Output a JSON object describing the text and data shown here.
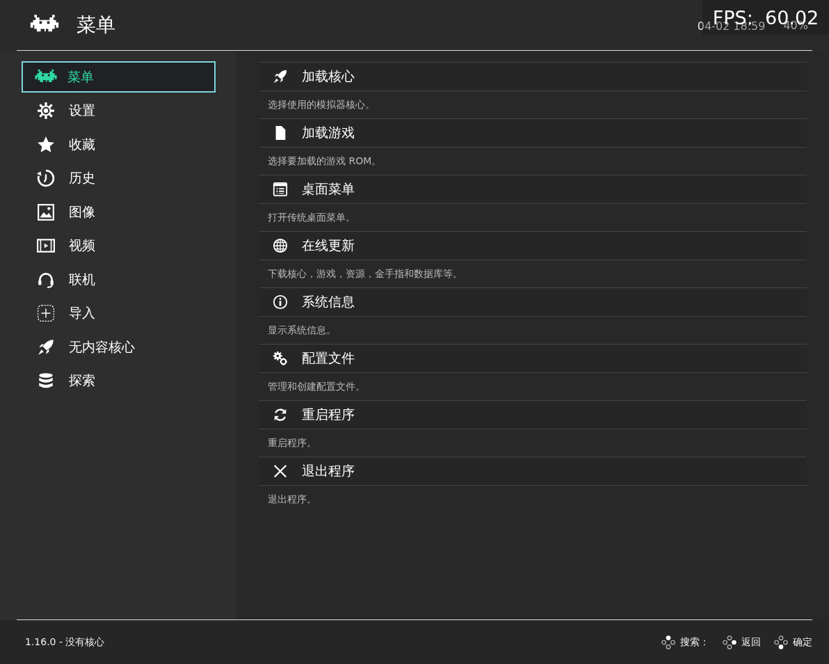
{
  "header": {
    "title": "菜单",
    "clock": "04-02 18:59",
    "battery": "40%"
  },
  "fps_overlay": "FPS:  60.02",
  "sidebar": {
    "items": [
      {
        "label": "菜单",
        "selected": true
      },
      {
        "label": "设置",
        "selected": false
      },
      {
        "label": "收藏",
        "selected": false
      },
      {
        "label": "历史",
        "selected": false
      },
      {
        "label": "图像",
        "selected": false
      },
      {
        "label": "视频",
        "selected": false
      },
      {
        "label": "联机",
        "selected": false
      },
      {
        "label": "导入",
        "selected": false
      },
      {
        "label": "无内容核心",
        "selected": false
      },
      {
        "label": "探索",
        "selected": false
      }
    ]
  },
  "menu": {
    "entries": [
      {
        "title": "加载核心",
        "description": "选择使用的模拟器核心。"
      },
      {
        "title": "加载游戏",
        "description": "选择要加载的游戏 ROM。"
      },
      {
        "title": "桌面菜单",
        "description": "打开传统桌面菜单。"
      },
      {
        "title": "在线更新",
        "description": "下载核心，游戏，资源，金手指和数据库等。"
      },
      {
        "title": "系统信息",
        "description": "显示系统信息。"
      },
      {
        "title": "配置文件",
        "description": "管理和创建配置文件。"
      },
      {
        "title": "重启程序",
        "description": "重启程序。"
      },
      {
        "title": "退出程序",
        "description": "退出程序。"
      }
    ]
  },
  "footer": {
    "version": "1.16.0 - 没有核心",
    "hints": [
      {
        "kind": "up",
        "label": "搜索："
      },
      {
        "kind": "right",
        "label": "返回"
      },
      {
        "kind": "down",
        "label": "确定"
      }
    ]
  }
}
